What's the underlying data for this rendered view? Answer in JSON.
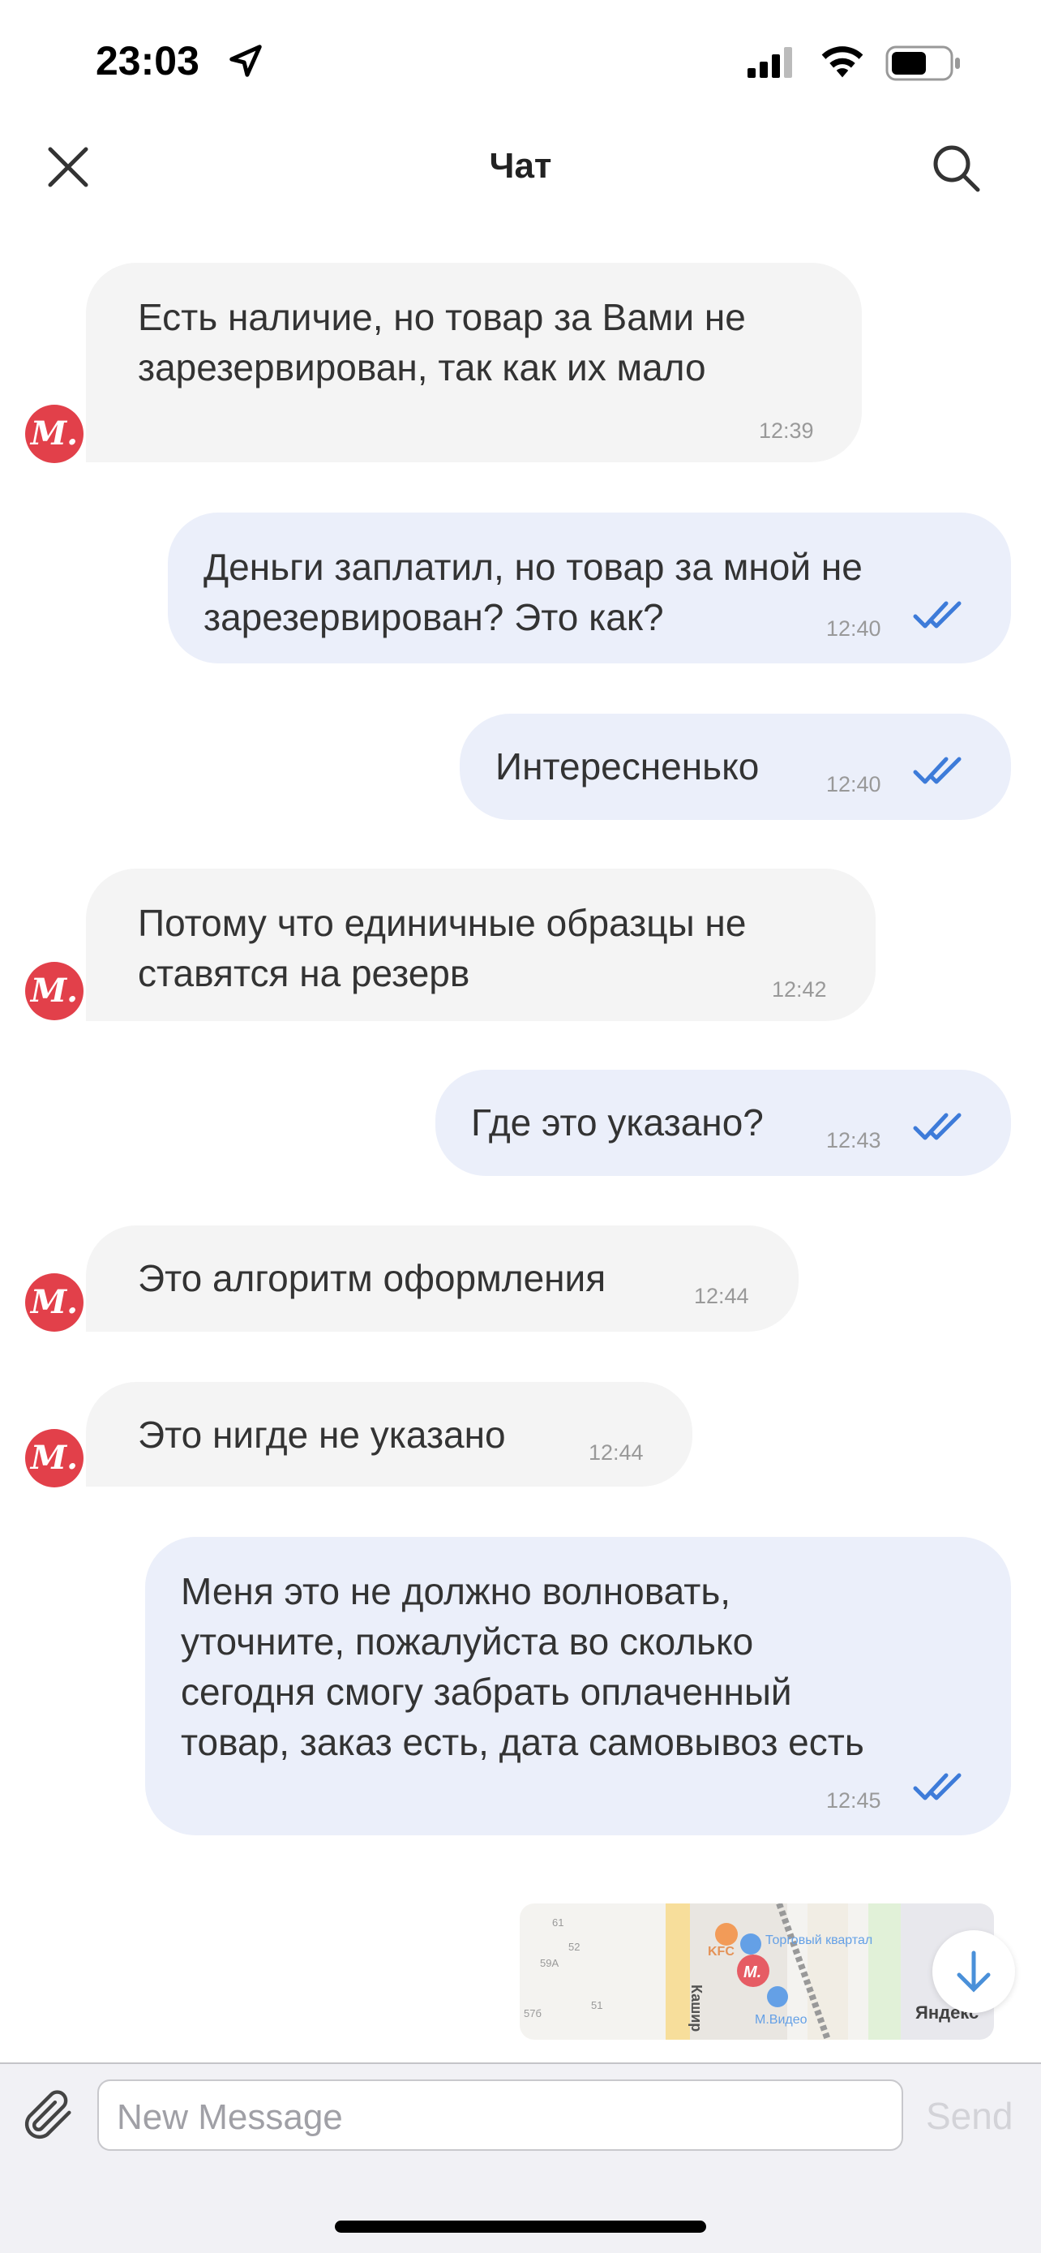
{
  "status_bar": {
    "time": "23:03",
    "icons": [
      "location-arrow-icon",
      "signal-icon",
      "wifi-icon",
      "battery-icon"
    ]
  },
  "header": {
    "title": "Чат",
    "close_icon": "close-icon",
    "search_icon": "search-icon"
  },
  "messages": [
    {
      "direction": "in",
      "lines": "Есть наличие, но товар за Вами не\nзарезервирован, так как их мало",
      "time": "12:39"
    },
    {
      "direction": "out",
      "lines": "Деньги заплатил, но товар за мной не\nзарезервирован? Это как?",
      "time": "12:40"
    },
    {
      "direction": "out",
      "lines": "Интересненько",
      "time": "12:40"
    },
    {
      "direction": "in",
      "lines": "Потому что единичные образцы не\nставятся на резерв",
      "time": "12:42"
    },
    {
      "direction": "out",
      "lines": "Где это указано?",
      "time": "12:43"
    },
    {
      "direction": "in",
      "lines": "Это алгоритм оформления",
      "time": "12:44"
    },
    {
      "direction": "in",
      "lines": "Это нигде не указано",
      "time": "12:44"
    },
    {
      "direction": "out",
      "lines": "Меня это не должно волновать,\nуточните, пожалуйста во сколько\nсегодня смогу забрать оплаченный\nтовар, заказ есть, дата самовывоз есть",
      "time": "12:45"
    }
  ],
  "avatar": {
    "letter": "М.",
    "color": "#e2404a"
  },
  "map": {
    "labels": [
      "KFC",
      "Торговый квартал",
      "М.Видео",
      "Кашир",
      "Яндекс",
      "61",
      "52",
      "59А",
      "57б",
      "51"
    ]
  },
  "composer": {
    "placeholder": "New Message",
    "send_label": "Send",
    "attach_icon": "paperclip-icon",
    "scroll_down_icon": "arrow-down-icon"
  },
  "colors": {
    "incoming": "#f4f4f4",
    "outgoing": "#ebeffa",
    "check": "#3d7bd9",
    "brand": "#e2404a"
  }
}
